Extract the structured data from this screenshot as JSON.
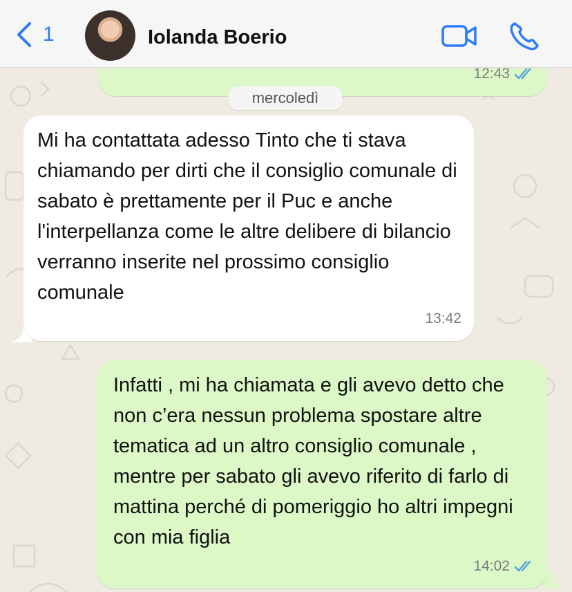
{
  "header": {
    "back_count": "1",
    "contact_name": "Iolanda Boerio",
    "icons": {
      "back": "chevron-left-icon",
      "video": "video-camera-icon",
      "call": "phone-icon"
    }
  },
  "chat": {
    "day_separator": "mercoledì",
    "messages": [
      {
        "direction": "outgoing",
        "text": "",
        "time": "12:43",
        "status": "read"
      },
      {
        "direction": "incoming",
        "text": "Mi ha contattata adesso Tinto che ti stava chiamando per dirti che il consiglio comunale di sabato è prettamente per il Puc e anche l'interpellanza come le altre delibere di bilancio verranno inserite nel prossimo consiglio comunale",
        "time": "13:42"
      },
      {
        "direction": "outgoing",
        "text": "Infatti , mi ha chiamata e gli  avevo detto che non c’era nessun problema spostare altre tematica ad un altro consiglio comunale , mentre per sabato gli avevo riferito di farlo di mattina perché di pomeriggio ho altri impegni con mia figlia",
        "time": "14:02",
        "status": "read"
      }
    ]
  },
  "colors": {
    "accent": "#2d7cf6",
    "outgoing_bubble": "#dcf8c6",
    "incoming_bubble": "#ffffff",
    "read_ticks": "#4fa3e0",
    "header_bg": "#f6f6f6",
    "chat_bg": "#efeae2"
  }
}
